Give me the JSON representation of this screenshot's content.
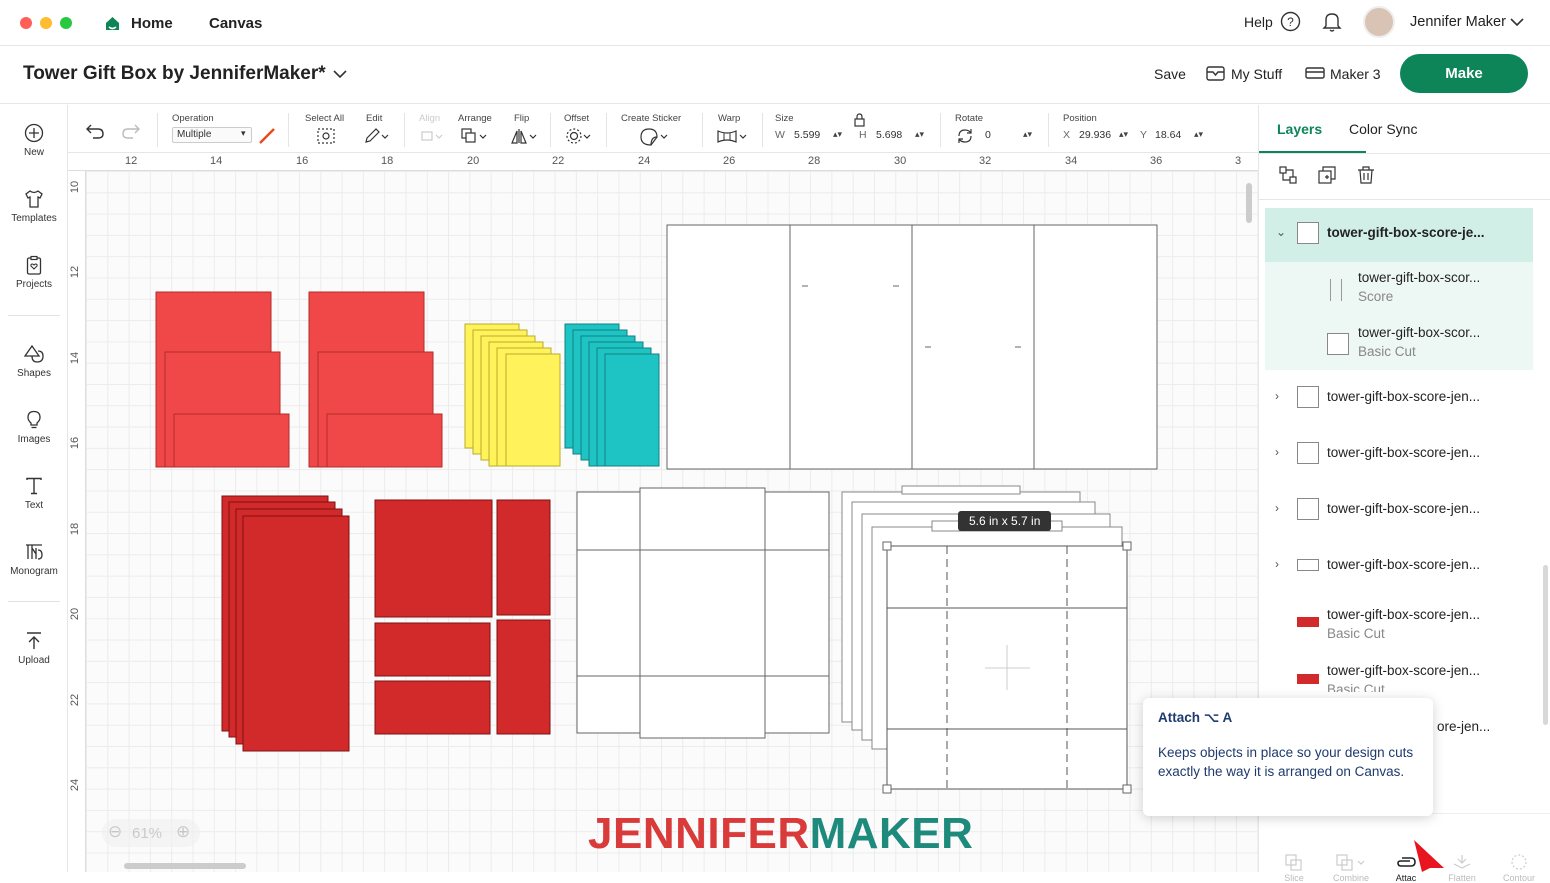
{
  "titlebar": {
    "tabs": [
      "Home",
      "Canvas"
    ],
    "help_label": "Help",
    "user_name": "Jennifer Maker"
  },
  "header": {
    "project_title": "Tower Gift Box by JenniferMaker*",
    "save_label": "Save",
    "my_stuff_label": "My Stuff",
    "machine_label": "Maker 3",
    "make_label": "Make"
  },
  "sidebar": {
    "items": [
      {
        "label": "New",
        "icon": "plus-circle-icon"
      },
      {
        "label": "Templates",
        "icon": "shirt-icon"
      },
      {
        "label": "Projects",
        "icon": "clipboard-heart-icon"
      },
      {
        "label": "Shapes",
        "icon": "shapes-icon"
      },
      {
        "label": "Images",
        "icon": "lightbulb-icon"
      },
      {
        "label": "Text",
        "icon": "text-icon"
      },
      {
        "label": "Monogram",
        "icon": "monogram-icon"
      },
      {
        "label": "Upload",
        "icon": "upload-icon"
      }
    ]
  },
  "toolbar": {
    "operation_label": "Operation",
    "operation_value": "Multiple",
    "select_all_label": "Select All",
    "edit_label": "Edit",
    "align_label": "Align",
    "arrange_label": "Arrange",
    "flip_label": "Flip",
    "offset_label": "Offset",
    "create_sticker_label": "Create Sticker",
    "warp_label": "Warp",
    "size_label": "Size",
    "w_label": "W",
    "w_value": "5.599",
    "h_label": "H",
    "h_value": "5.698",
    "rotate_label": "Rotate",
    "rotate_value": "0",
    "position_label": "Position",
    "x_label": "X",
    "x_value": "29.936",
    "y_label": "Y",
    "y_value": "18.64",
    "accent_color": "#e84a1b"
  },
  "ruler": {
    "top": [
      "12",
      "14",
      "16",
      "18",
      "20",
      "22",
      "24",
      "26",
      "28",
      "30",
      "32",
      "34",
      "36",
      "3"
    ],
    "left": [
      "10",
      "12",
      "14",
      "16",
      "18",
      "20",
      "22",
      "24"
    ]
  },
  "canvas": {
    "size_tag": "5.6  in x 5.7  in",
    "zoom_value": "61%",
    "watermark_part1": "JENNIFER",
    "watermark_part2": "MAKER",
    "colors": {
      "red": "#f04848",
      "dark_red": "#d22a2a",
      "yellow": "#fff25a",
      "teal": "#1ec4c4",
      "brand_red": "#d93a3a",
      "brand_teal": "#1d8a7c"
    }
  },
  "panel": {
    "tab_layers": "Layers",
    "tab_color_sync": "Color Sync",
    "layers": [
      {
        "name": "tower-gift-box-score-je...",
        "sub": ""
      },
      {
        "name": "tower-gift-box-scor...",
        "sub": "Score"
      },
      {
        "name": "tower-gift-box-scor...",
        "sub": "Basic Cut"
      },
      {
        "name": "tower-gift-box-score-jen...",
        "sub": ""
      },
      {
        "name": "tower-gift-box-score-jen...",
        "sub": ""
      },
      {
        "name": "tower-gift-box-score-jen...",
        "sub": ""
      },
      {
        "name": "tower-gift-box-score-jen...",
        "sub": ""
      },
      {
        "name": "tower-gift-box-score-jen...",
        "sub": "Basic Cut"
      },
      {
        "name": "tower-gift-box-score-jen...",
        "sub": "Basic Cut"
      },
      {
        "name": "ore-jen...",
        "sub": ""
      }
    ],
    "bottom_tools": [
      "Slice",
      "Combine",
      "Attac",
      "Flatten",
      "Contour"
    ]
  },
  "tooltip": {
    "title": "Attach ⌥ A",
    "body": "Keeps objects in place so your design cuts exactly the way it is arranged on Canvas."
  }
}
